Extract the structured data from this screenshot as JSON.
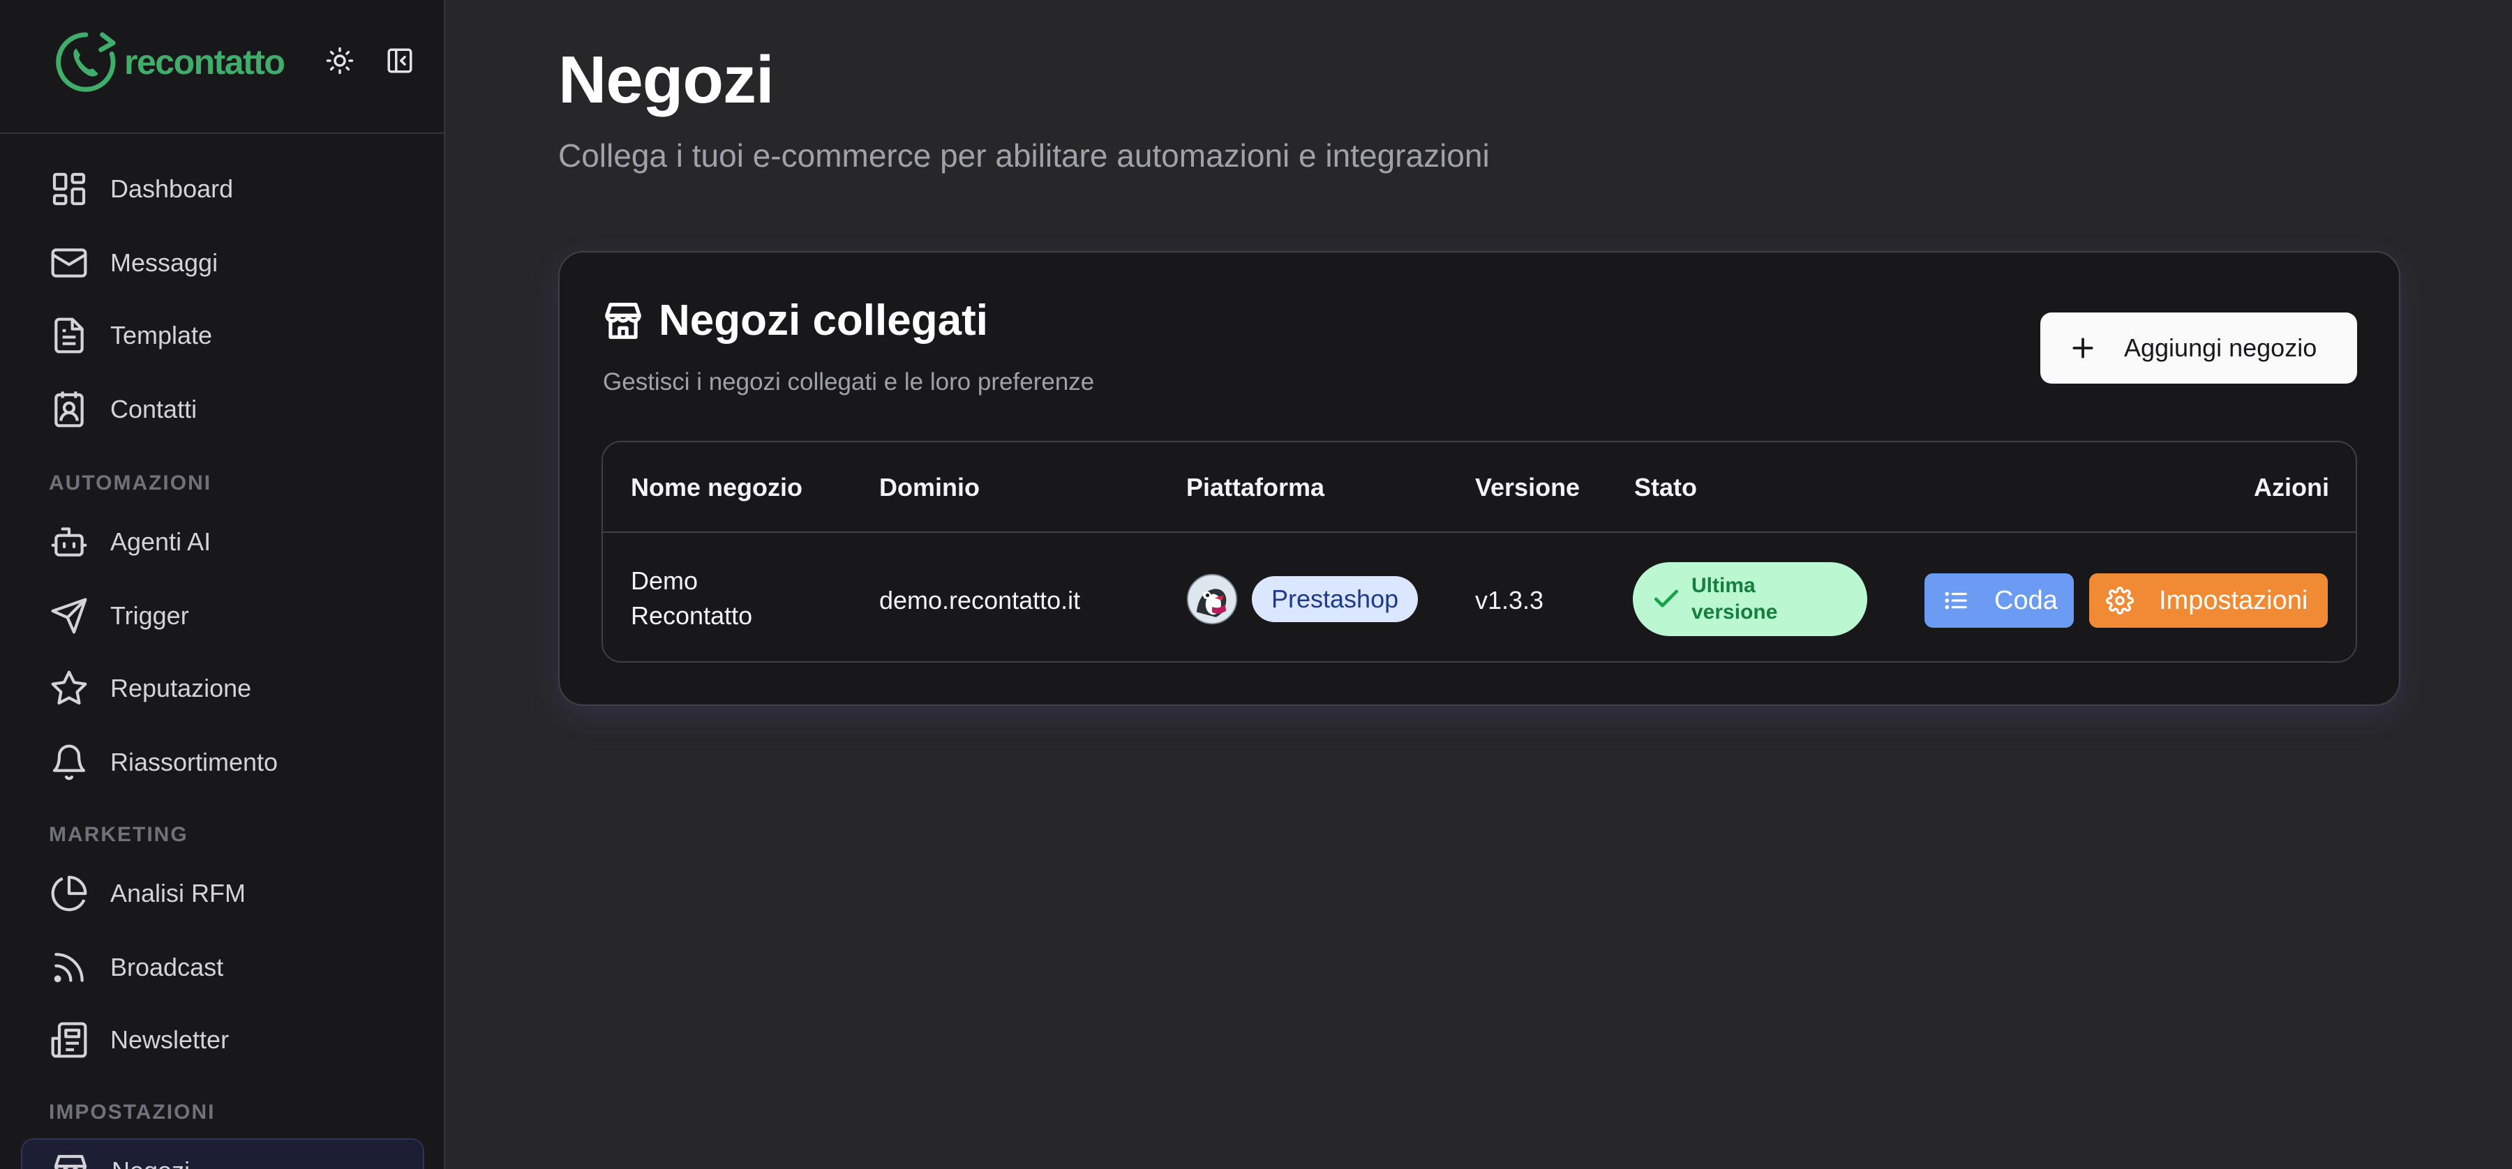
{
  "app": {
    "logo_text": "recontatto",
    "brand_color": "#3fae6a"
  },
  "sidebar": {
    "items": [
      {
        "label": "Dashboard",
        "icon": "dashboard-icon"
      },
      {
        "label": "Messaggi",
        "icon": "mail-icon"
      },
      {
        "label": "Template",
        "icon": "document-icon"
      },
      {
        "label": "Contatti",
        "icon": "contact-card-icon"
      }
    ],
    "sections": [
      {
        "title": "AUTOMAZIONI",
        "items": [
          {
            "label": "Agenti AI",
            "icon": "robot-icon"
          },
          {
            "label": "Trigger",
            "icon": "send-icon"
          },
          {
            "label": "Reputazione",
            "icon": "star-icon"
          },
          {
            "label": "Riassortimento",
            "icon": "bell-icon"
          }
        ]
      },
      {
        "title": "MARKETING",
        "items": [
          {
            "label": "Analisi RFM",
            "icon": "pie-chart-icon"
          },
          {
            "label": "Broadcast",
            "icon": "rss-icon"
          },
          {
            "label": "Newsletter",
            "icon": "newspaper-icon"
          }
        ]
      },
      {
        "title": "IMPOSTAZIONI",
        "items": [
          {
            "label": "Negozi",
            "icon": "store-icon",
            "active": true
          }
        ]
      }
    ]
  },
  "page": {
    "title": "Negozi",
    "subtitle": "Collega i tuoi e-commerce per abilitare automazioni e integrazioni"
  },
  "card": {
    "title": "Negozi collegati",
    "description": "Gestisci i negozi collegati e le loro preferenze",
    "add_button": "Aggiungi negozio"
  },
  "table": {
    "headers": {
      "name": "Nome negozio",
      "domain": "Dominio",
      "platform": "Piattaforma",
      "version": "Versione",
      "status": "Stato",
      "actions": "Azioni"
    },
    "rows": [
      {
        "name_line1": "Demo",
        "name_line2": "Recontatto",
        "domain": "demo.recontatto.it",
        "platform": "Prestashop",
        "version": "v1.3.3",
        "status": "Ultima versione",
        "queue_button": "Coda",
        "settings_button": "Impostazioni"
      }
    ]
  },
  "colors": {
    "background": "#27272a",
    "sidebar": "#18181b",
    "badge_success": "#bbf7d0",
    "button_queue": "#6b9bf2",
    "button_settings": "#f08a35"
  }
}
